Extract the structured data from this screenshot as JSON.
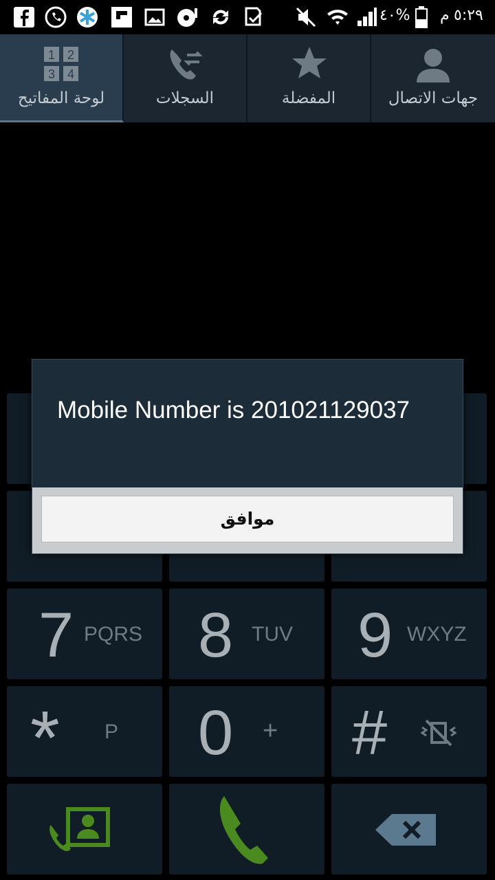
{
  "status_bar": {
    "battery_percent": "٤٠%",
    "time": "٥:٢٩",
    "ampm": "م",
    "icons": [
      "facebook-icon",
      "whatsapp-icon",
      "asterisk-app-icon",
      "flipboard-icon",
      "gallery-icon",
      "media-disc-icon",
      "sync-icon",
      "download-done-icon",
      "mute-icon",
      "wifi-icon",
      "signal-icon",
      "battery-icon"
    ]
  },
  "tabs": [
    {
      "label": "لوحة المفاتيح",
      "icon": "keypad-grid-icon",
      "active": true
    },
    {
      "label": "السجلات",
      "icon": "call-log-icon",
      "active": false
    },
    {
      "label": "المفضلة",
      "icon": "star-icon",
      "active": false
    },
    {
      "label": "جهات الاتصال",
      "icon": "contact-person-icon",
      "active": false
    }
  ],
  "keypad": {
    "keys": [
      {
        "digit": "7",
        "letters": "PQRS"
      },
      {
        "digit": "8",
        "letters": "TUV"
      },
      {
        "digit": "9",
        "letters": "WXYZ"
      },
      {
        "digit": "*",
        "letters": "P"
      },
      {
        "digit": "0",
        "letters": "+"
      },
      {
        "digit": "#",
        "letters": ""
      }
    ],
    "bottom_actions": [
      "add-contact-icon",
      "call-icon",
      "backspace-icon"
    ]
  },
  "dialog": {
    "message": "Mobile Number is 201021129037",
    "ok_label": "موافق"
  },
  "colors": {
    "tab_bg": "#1b2631",
    "tab_active_bg": "#2a3d4f",
    "key_bg": "#111d26",
    "dialog_bg": "#1d2c39",
    "call_green": "#4a8a1e"
  }
}
